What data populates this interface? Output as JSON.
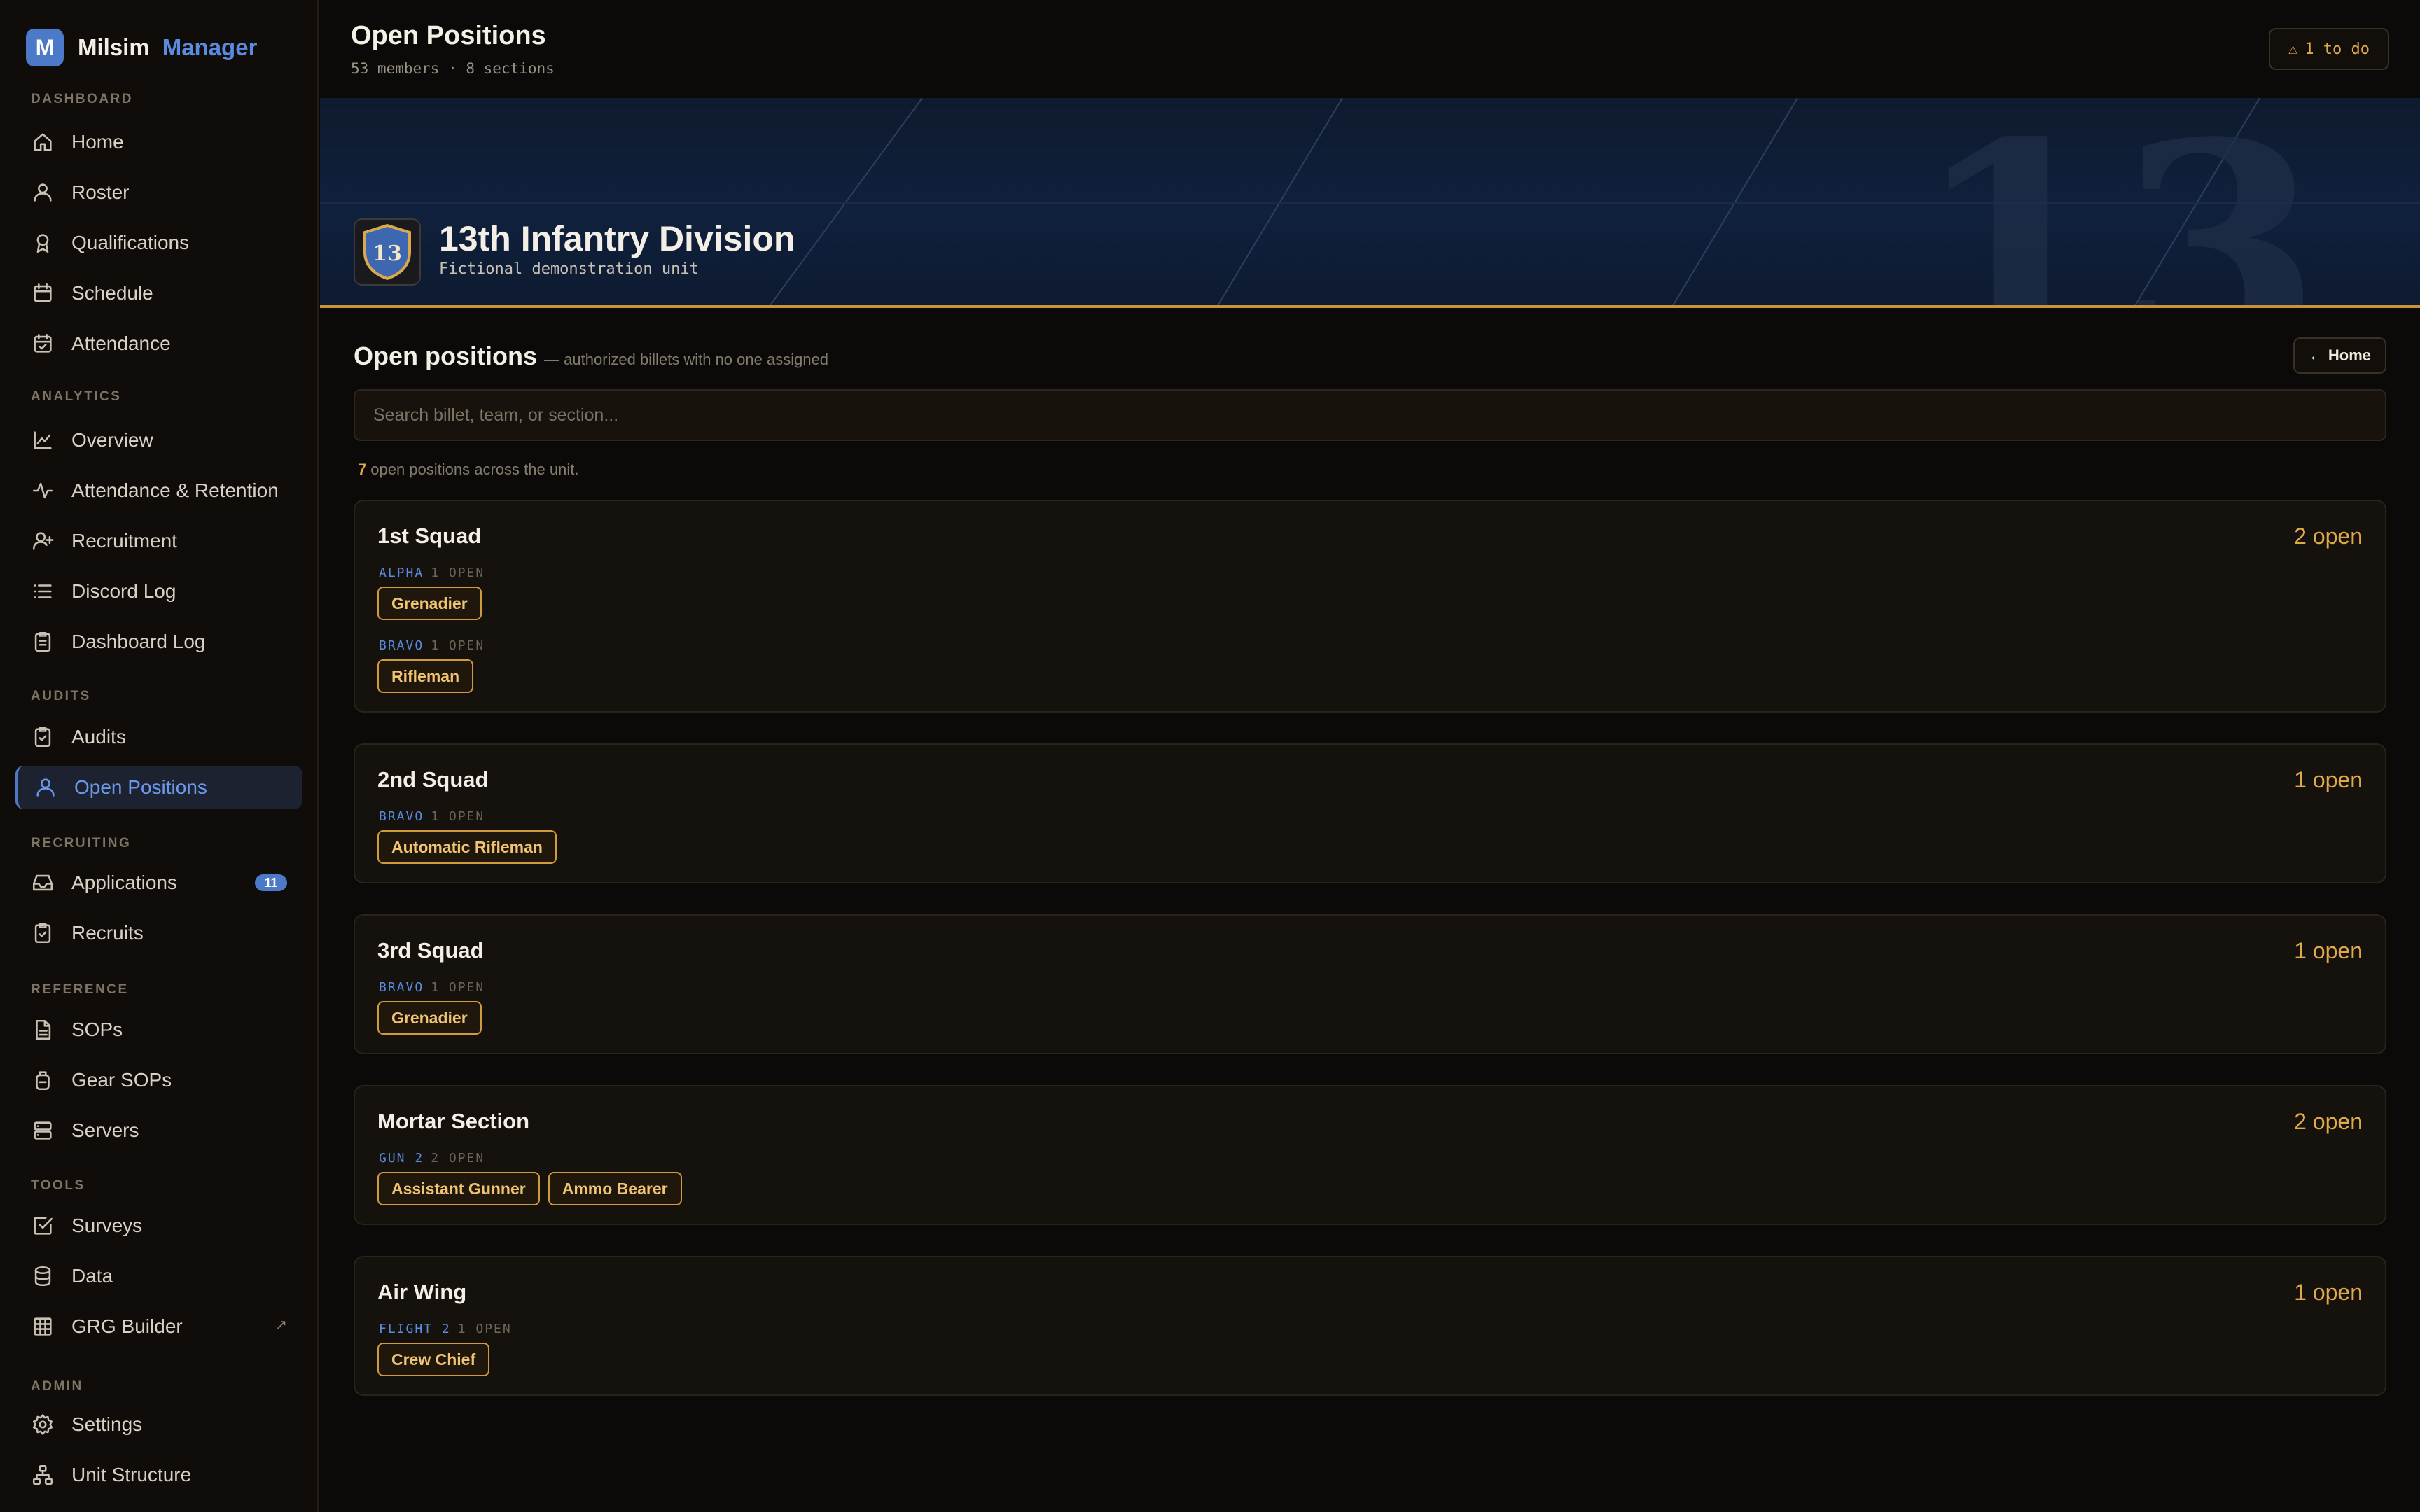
{
  "app": {
    "logo_letter": "M",
    "name": "Milsim",
    "name_accent": "Manager"
  },
  "sidebar": {
    "sections": [
      {
        "label": "DASHBOARD",
        "items": [
          {
            "label": "Home",
            "icon": "home-icon"
          },
          {
            "label": "Roster",
            "icon": "user-icon"
          },
          {
            "label": "Qualifications",
            "icon": "award-icon"
          },
          {
            "label": "Schedule",
            "icon": "calendar-icon"
          },
          {
            "label": "Attendance",
            "icon": "calendar-check-icon"
          }
        ]
      },
      {
        "label": "ANALYTICS",
        "items": [
          {
            "label": "Overview",
            "icon": "line-chart-icon"
          },
          {
            "label": "Attendance & Retention",
            "icon": "activity-icon"
          },
          {
            "label": "Recruitment",
            "icon": "user-plus-icon"
          },
          {
            "label": "Discord Log",
            "icon": "list-icon"
          },
          {
            "label": "Dashboard Log",
            "icon": "clipboard-icon"
          }
        ]
      },
      {
        "label": "AUDITS",
        "items": [
          {
            "label": "Audits",
            "icon": "clipboard-check-icon"
          },
          {
            "label": "Open Positions",
            "icon": "user-icon",
            "active": true
          }
        ]
      },
      {
        "label": "RECRUITING",
        "items": [
          {
            "label": "Applications",
            "icon": "inbox-icon",
            "badge": "11"
          },
          {
            "label": "Recruits",
            "icon": "clipboard-check-icon"
          }
        ]
      },
      {
        "label": "REFERENCE",
        "items": [
          {
            "label": "SOPs",
            "icon": "file-text-icon"
          },
          {
            "label": "Gear SOPs",
            "icon": "backpack-icon"
          },
          {
            "label": "Servers",
            "icon": "server-icon"
          }
        ]
      },
      {
        "label": "TOOLS",
        "items": [
          {
            "label": "Surveys",
            "icon": "check-square-icon"
          },
          {
            "label": "Data",
            "icon": "database-icon"
          },
          {
            "label": "GRG Builder",
            "icon": "grid-icon",
            "external": "↗"
          }
        ]
      },
      {
        "label": "ADMIN",
        "items": [
          {
            "label": "Settings",
            "icon": "gear-icon"
          },
          {
            "label": "Unit Structure",
            "icon": "hierarchy-icon"
          }
        ]
      }
    ]
  },
  "header": {
    "title": "Open Positions",
    "meta": "53 members · 8 sections",
    "todo_label": "1 to do"
  },
  "banner": {
    "unit_name": "13th Infantry Division",
    "unit_sub": "Fictional demonstration unit",
    "crest_number": "13",
    "watermark": "13"
  },
  "content": {
    "title": "Open positions",
    "description": "— authorized billets with no one assigned",
    "home_button": "← Home",
    "search_placeholder": "Search billet, team, or section...",
    "count": "7",
    "count_suffix": "open positions across the unit."
  },
  "cards": [
    {
      "title": "1st Squad",
      "open": "2 open",
      "teams": [
        {
          "name": "ALPHA",
          "open": "1 OPEN",
          "billets": [
            "Grenadier"
          ]
        },
        {
          "name": "BRAVO",
          "open": "1 OPEN",
          "billets": [
            "Rifleman"
          ]
        }
      ]
    },
    {
      "title": "2nd Squad",
      "open": "1 open",
      "teams": [
        {
          "name": "BRAVO",
          "open": "1 OPEN",
          "billets": [
            "Automatic Rifleman"
          ]
        }
      ]
    },
    {
      "title": "3rd Squad",
      "open": "1 open",
      "teams": [
        {
          "name": "BRAVO",
          "open": "1 OPEN",
          "billets": [
            "Grenadier"
          ]
        }
      ]
    },
    {
      "title": "Mortar Section",
      "open": "2 open",
      "teams": [
        {
          "name": "GUN 2",
          "open": "2 OPEN",
          "billets": [
            "Assistant Gunner",
            "Ammo Bearer"
          ]
        }
      ]
    },
    {
      "title": "Air Wing",
      "open": "1 open",
      "teams": [
        {
          "name": "FLIGHT 2",
          "open": "1 OPEN",
          "billets": [
            "Crew Chief"
          ]
        }
      ]
    }
  ],
  "colors": {
    "accent_blue": "#4d79c9",
    "accent_gold": "#e0a94a",
    "background": "#0c0a08"
  }
}
